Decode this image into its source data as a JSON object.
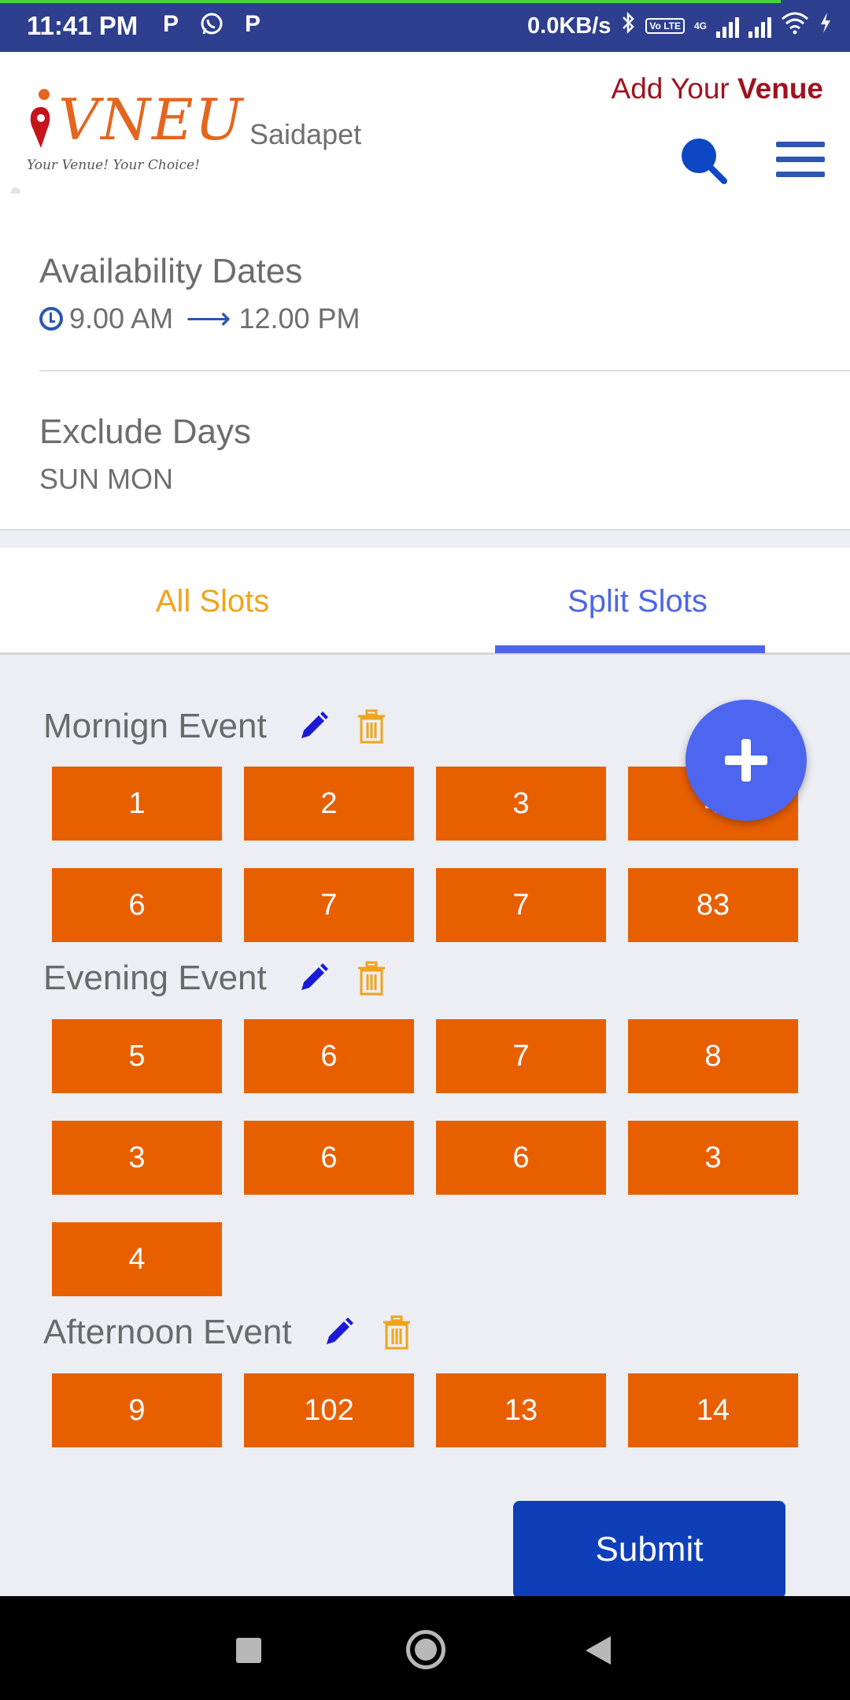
{
  "status_bar": {
    "time": "11:41 PM",
    "network_speed": "0.0KB/s",
    "network_type": "4G",
    "volte_label": "Vo LTE",
    "notification_icons": [
      "p-icon",
      "whatsapp-icon",
      "p-icon"
    ]
  },
  "header": {
    "logo_text": "VNEU",
    "logo_tagline": "Your Venue! Your Choice!",
    "location": "Saidapet",
    "add_venue_prefix": "Add Your ",
    "add_venue_bold": "Venue"
  },
  "availability": {
    "title": "Availability Dates",
    "start_time": "9.00 AM",
    "end_time": "12.00 PM"
  },
  "exclude": {
    "title": "Exclude Days",
    "days": "SUN MON"
  },
  "tabs": [
    {
      "label": "All Slots",
      "active": false
    },
    {
      "label": "Split Slots",
      "active": true
    }
  ],
  "events": [
    {
      "name": "Mornign Event",
      "slots": [
        "1",
        "2",
        "3",
        "4",
        "6",
        "7",
        "7",
        "83"
      ]
    },
    {
      "name": "Evening Event",
      "slots": [
        "5",
        "6",
        "7",
        "8",
        "3",
        "6",
        "6",
        "3",
        "4"
      ]
    },
    {
      "name": "Afternoon Event",
      "slots": [
        "9",
        "102",
        "13",
        "14"
      ]
    }
  ],
  "submit_label": "Submit",
  "colors": {
    "status_bar": "#2e3f8f",
    "slot": "#e85f00",
    "tab_active": "#4d66e8",
    "tab_inactive": "#f0a41c",
    "submit": "#0f3fb8",
    "add_venue": "#a0121e"
  }
}
